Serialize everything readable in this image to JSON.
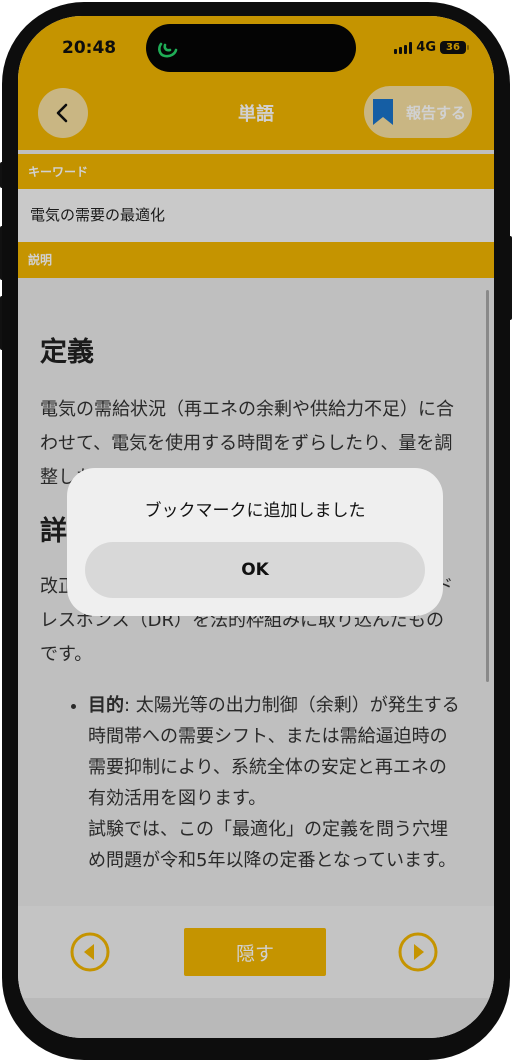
{
  "status": {
    "time": "20:48",
    "network": "4G",
    "battery": "36"
  },
  "nav": {
    "title": "単語",
    "report_label": "報告する"
  },
  "keyword": {
    "header": "キーワード",
    "value": "電気の需要の最適化"
  },
  "description": {
    "header": "説明",
    "definition_heading": "定義",
    "definition_text": "電気の需給状況（再エネの余剰や供給力不足）に合わせて、電気を使用する時間をずらしたり、量を調整したりすることです。",
    "detail_heading": "詳細",
    "detail_text": "改正省エネ法で新たに導入された概念で、デマンドレスポンス（DR）を法的枠組みに取り込んだものです。",
    "bullet_label": "目的",
    "bullet_text": ": 太陽光等の出力制御（余剰）が発生する時間帯への需要シフト、または需給逼迫時の需要抑制により、系統全体の安定と再エネの有効活用を図ります。",
    "bullet_note": "試験では、この「最適化」の定義を問う穴埋め問題が令和5年以降の定番となっています。"
  },
  "bottom": {
    "hide_label": "隠す"
  },
  "alert": {
    "message": "ブックマークに追加しました",
    "ok_label": "OK"
  },
  "colors": {
    "accent": "#f1b500",
    "bookmark": "#1a73c8"
  },
  "icons": {
    "back": "chevron-left-icon",
    "bookmark": "bookmark-icon",
    "prev": "circle-left-icon",
    "next": "circle-right-icon"
  }
}
